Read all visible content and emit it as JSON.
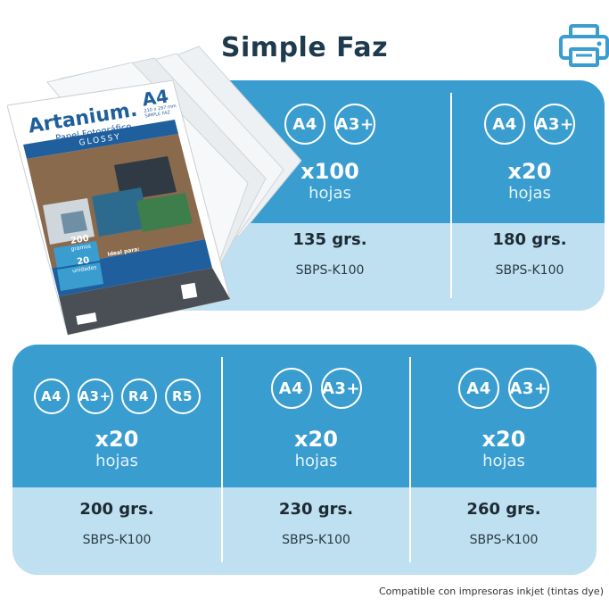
{
  "title": "Simple Faz",
  "colors": {
    "panel_blue": "#3a9dd0",
    "panel_light": "#bfe0f1",
    "title": "#1e3a4d"
  },
  "package": {
    "brand": "Artanium.",
    "subtitle": "Papel Fotográfico",
    "format": "A4",
    "format_note": "210 x 297 mm",
    "type_note": "SIMPLE FAZ",
    "finish": "GLOSSY",
    "grams_value": "200",
    "grams_label": "gramos",
    "units_value": "20",
    "units_label": "unidades",
    "ideal_label": "Ideal para:"
  },
  "top_panel": {
    "columns": [
      {
        "badges": [
          "A4",
          "A3+"
        ],
        "qty": "x100",
        "unit": "hojas",
        "grams": "135 grs.",
        "code": "SBPS-K100"
      },
      {
        "badges": [
          "A4",
          "A3+"
        ],
        "qty": "x20",
        "unit": "hojas",
        "grams": "180 grs.",
        "code": "SBPS-K100"
      }
    ]
  },
  "bottom_panel": {
    "columns": [
      {
        "badges": [
          "A4",
          "A3+",
          "R4",
          "R5"
        ],
        "qty": "x20",
        "unit": "hojas",
        "grams": "200 grs.",
        "code": "SBPS-K100"
      },
      {
        "badges": [
          "A4",
          "A3+"
        ],
        "qty": "x20",
        "unit": "hojas",
        "grams": "230 grs.",
        "code": "SBPS-K100"
      },
      {
        "badges": [
          "A4",
          "A3+"
        ],
        "qty": "x20",
        "unit": "hojas",
        "grams": "260 grs.",
        "code": "SBPS-K100"
      }
    ]
  },
  "footer": "Compatible con impresoras inkjet (tintas dye)"
}
